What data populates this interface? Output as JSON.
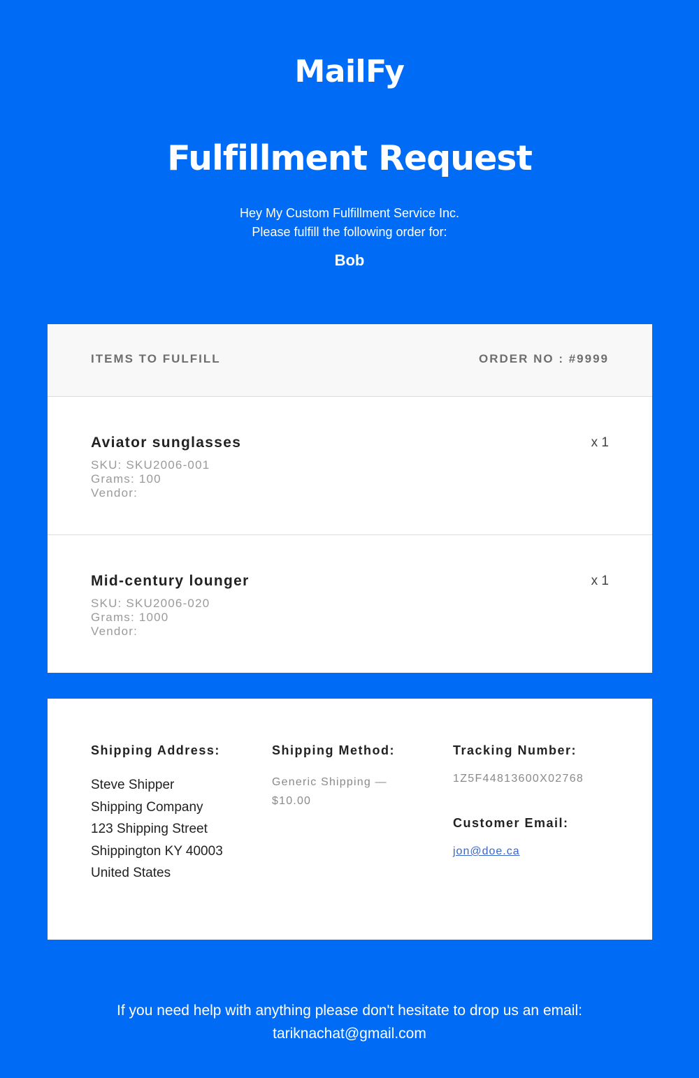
{
  "brand": "MailFy",
  "title": "Fulfillment Request",
  "intro": {
    "line1": "Hey My Custom Fulfillment Service Inc.",
    "line2": "Please fulfill the following order for:",
    "customer": "Bob"
  },
  "items_card": {
    "header_label": "ITEMS TO FULFILL",
    "order_no": "ORDER NO : #9999",
    "items": [
      {
        "name": "Aviator sunglasses",
        "qty": "x 1",
        "sku": "SKU: SKU2006-001",
        "grams": "Grams: 100",
        "vendor": "Vendor:"
      },
      {
        "name": "Mid-century lounger",
        "qty": "x 1",
        "sku": "SKU: SKU2006-020",
        "grams": "Grams: 1000",
        "vendor": "Vendor:"
      }
    ]
  },
  "shipping": {
    "address_heading": "Shipping Address:",
    "address_lines": [
      "Steve Shipper",
      "Shipping Company",
      "123 Shipping Street",
      "Shippington KY 40003",
      "United States"
    ],
    "method_heading": "Shipping Method:",
    "method": "Generic Shipping — $10.00",
    "tracking_heading": "Tracking Number:",
    "tracking": "1Z5F44813600X02768",
    "email_heading": "Customer Email:",
    "email": "jon@doe.ca"
  },
  "footer": {
    "line1": "If you need help with anything please don't hesitate to drop us an email:",
    "line2": "tariknachat@gmail.com"
  },
  "colors": {
    "background": "#006bf5",
    "link": "#3a66c9"
  }
}
